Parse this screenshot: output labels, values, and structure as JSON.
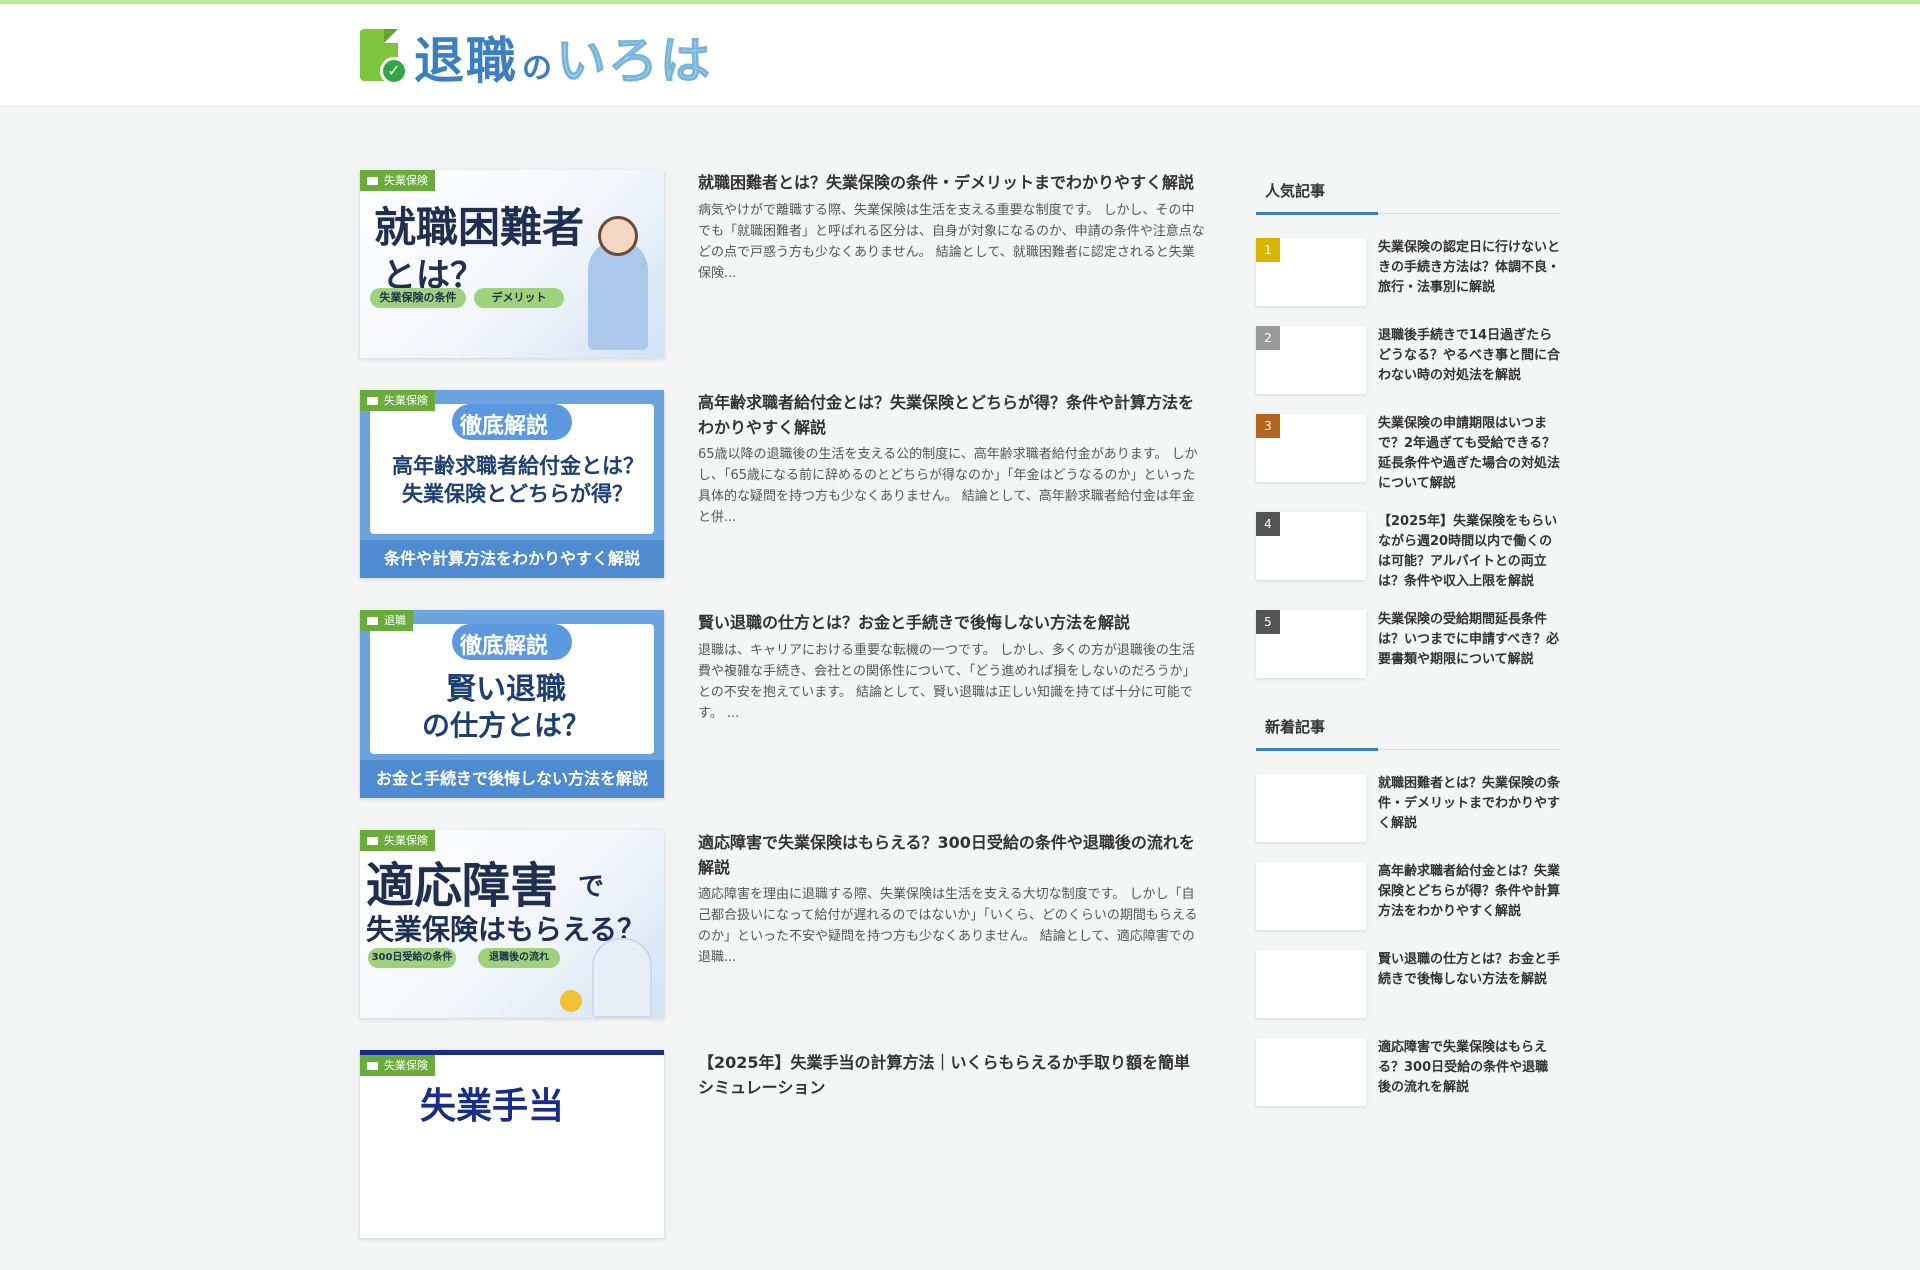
{
  "site": {
    "logo_text_a": "退職",
    "logo_text_b": "の",
    "logo_text_c": "いろは"
  },
  "articles": [
    {
      "category": "失業保険",
      "title": "就職困難者とは？失業保険の条件・デメリットまでわかりやすく解説",
      "excerpt": "病気やけがで離職する際、失業保険は生活を支える重要な制度です。 しかし、その中でも「就職困難者」と呼ばれる区分は、自身が対象になるのか、申請の条件や注意点などの点で戸惑う方も少なくありません。 結論として、就職困難者に認定されると失業保険...",
      "thumb": {
        "line1": "就職困難者",
        "line2": "とは？",
        "pill1": "失業保険の条件",
        "pill2": "デメリット"
      }
    },
    {
      "category": "失業保険",
      "title": "高年齢求職者給付金とは？失業保険とどちらが得？条件や計算方法をわかりやすく解説",
      "excerpt": "65歳以降の退職後の生活を支える公的制度に、高年齢求職者給付金があります。 しかし、「65歳になる前に辞めるのとどちらが得なのか」「年金はどうなるのか」といった具体的な疑問を持つ方も少なくありません。 結論として、高年齢求職者給付金は年金と併...",
      "thumb": {
        "badge": "徹底解説",
        "line1": "高年齢求職者給付金とは？",
        "line2": "失業保険とどちらが得？",
        "band": "条件や計算方法をわかりやすく解説"
      }
    },
    {
      "category": "退職",
      "title": "賢い退職の仕方とは？お金と手続きで後悔しない方法を解説",
      "excerpt": "退職は、キャリアにおける重要な転機の一つです。 しかし、多くの方が退職後の生活費や複雑な手続き、会社との関係性について、「どう進めれば損をしないのだろうか」との不安を抱えています。 結論として、賢い退職は正しい知識を持てば十分に可能です。 ...",
      "thumb": {
        "badge": "徹底解説",
        "line1": "賢い退職",
        "line2": "の仕方とは？",
        "band": "お金と手続きで後悔しない方法を解説"
      }
    },
    {
      "category": "失業保険",
      "title": "適応障害で失業保険はもらえる？300日受給の条件や退職後の流れを解説",
      "excerpt": "適応障害を理由に退職する際、失業保険は生活を支える大切な制度です。 しかし「自己都合扱いになって給付が遅れるのではないか」「いくら、どのくらいの期間もらえるのか」といった不安や疑問を持つ方も少なくありません。 結論として、適応障害での退職...",
      "thumb": {
        "line1": "適応障害",
        "line1b": "で",
        "line2": "失業保険はもらえる？",
        "pill1": "300日受給の条件",
        "pill2": "退職後の流れ"
      }
    },
    {
      "category": "失業保険",
      "title": "【2025年】失業手当の計算方法｜いくらもらえるか手取り額を簡単シミュレーション",
      "excerpt": "",
      "thumb": {
        "line1": "失業手当"
      }
    }
  ],
  "sidebar": {
    "popular_heading": "人気記事",
    "popular": [
      {
        "rank": "1",
        "title": "失業保険の認定日に行けないときの手続き方法は？体調不良・旅行・法事別に解説"
      },
      {
        "rank": "2",
        "title": "退職後手続きで14日過ぎたらどうなる？やるべき事と間に合わない時の対処法を解説"
      },
      {
        "rank": "3",
        "title": "失業保険の申請期限はいつまで？2年過ぎても受給できる？延長条件や過ぎた場合の対処法について解説"
      },
      {
        "rank": "4",
        "title": "【2025年】失業保険をもらいながら週20時間以内で働くのは可能？アルバイトとの両立は？条件や収入上限を解説"
      },
      {
        "rank": "5",
        "title": "失業保険の受給期間延長条件は？いつまでに申請すべき？必要書類や期限について解説"
      }
    ],
    "new_heading": "新着記事",
    "new": [
      {
        "title": "就職困難者とは？失業保険の条件・デメリットまでわかりやすく解説"
      },
      {
        "title": "高年齢求職者給付金とは？失業保険とどちらが得？条件や計算方法をわかりやすく解説"
      },
      {
        "title": "賢い退職の仕方とは？お金と手続きで後悔しない方法を解説"
      },
      {
        "title": "適応障害で失業保険はもらえる？300日受給の条件や退職後の流れを解説"
      }
    ]
  },
  "colors": {
    "accent": "#6aac3b",
    "link_blue": "#3a7fc4",
    "top_line": "#b7ef93",
    "rank1": "#d9b400",
    "rank2": "#9a9a9a",
    "rank3": "#b5651d",
    "rank_other": "#555555"
  }
}
